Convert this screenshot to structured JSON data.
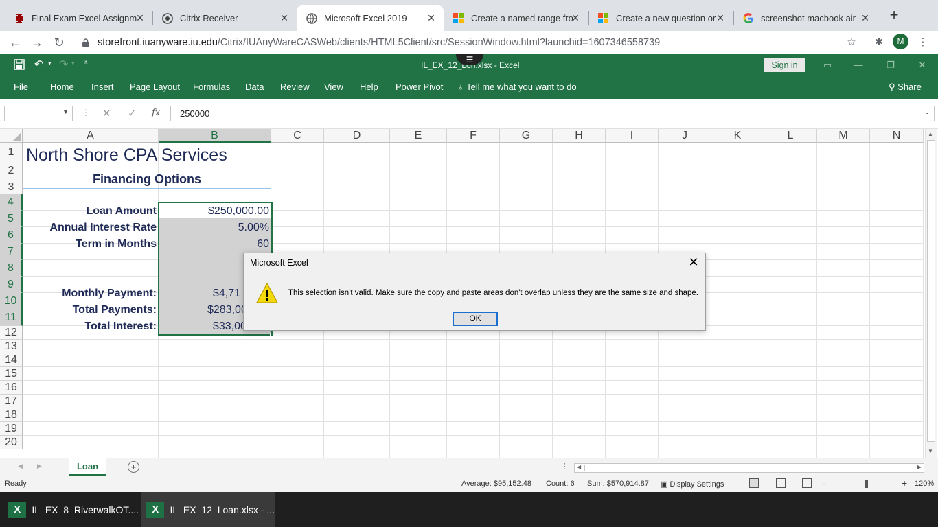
{
  "browser": {
    "tabs": [
      {
        "label": "Final Exam Excel Assignm",
        "icon": "iu-logo-icon",
        "active": false
      },
      {
        "label": "Citrix Receiver",
        "icon": "citrix-icon",
        "active": false
      },
      {
        "label": "Microsoft Excel 2019",
        "icon": "globe-icon",
        "active": true
      },
      {
        "label": "Create a named range fro",
        "icon": "microsoft-icon",
        "active": false
      },
      {
        "label": "Create a new question or",
        "icon": "microsoft-icon",
        "active": false
      },
      {
        "label": "screenshot macbook air -",
        "icon": "google-icon",
        "active": false
      }
    ],
    "url_host": "storefront.iuanyware.iu.edu",
    "url_path": "/Citrix/IUAnyWareCASWeb/clients/HTML5Client/src/SessionWindow.html?launchid=1607346558739",
    "profile_initial": "M"
  },
  "excel": {
    "title": "IL_EX_12_Lo",
    "title_rest": "n.xlsx  -  Excel",
    "sign_in": "Sign in",
    "ribbon_tabs": [
      "File",
      "Home",
      "Insert",
      "Page Layout",
      "Formulas",
      "Data",
      "Review",
      "View",
      "Help",
      "Power Pivot"
    ],
    "tell_me": "Tell me what you want to do",
    "share": "Share",
    "name_box": "",
    "formula_value": "250000",
    "fx_label": "fx",
    "columns": [
      "A",
      "B",
      "C",
      "D",
      "E",
      "F",
      "G",
      "H",
      "I",
      "J",
      "K",
      "L",
      "M",
      "N"
    ],
    "rows": [
      "1",
      "2",
      "3",
      "4",
      "5",
      "6",
      "7",
      "8",
      "9",
      "10",
      "11",
      "12",
      "13",
      "14",
      "15",
      "16",
      "17",
      "18",
      "19",
      "20"
    ],
    "cells": {
      "a1": "North Shore CPA Services",
      "a2": "Financing Options",
      "a4": "Loan Amount",
      "b4": "$250,000.00",
      "a5": "Annual Interest Rate",
      "b5": "5.00%",
      "a6": "Term in Months",
      "b6": "60",
      "a9": "Monthly Payment:",
      "b9": "$4,71",
      "a10": "Total Payments:",
      "b10": "$283,00",
      "a11": "Total Interest:",
      "b11": "$33,00"
    },
    "sheet_tab": "Loan",
    "status": {
      "ready": "Ready",
      "average": "Average: $95,152.48",
      "count": "Count: 6",
      "sum": "Sum: $570,914.87",
      "display_settings": "Display Settings",
      "zoom": "120%"
    }
  },
  "dialog": {
    "title": "Microsoft Excel",
    "message": "This selection isn't valid. Make sure the copy and paste areas don't overlap unless they are the same size and shape.",
    "ok": "OK"
  },
  "taskbar": {
    "items": [
      {
        "label": "IL_EX_8_RiverwalkOT...."
      },
      {
        "label": "IL_EX_12_Loan.xlsx - ..."
      }
    ]
  },
  "colors": {
    "excel_green": "#217346",
    "cell_text": "#1f2a57",
    "warning_yellow": "#f4d90a"
  }
}
